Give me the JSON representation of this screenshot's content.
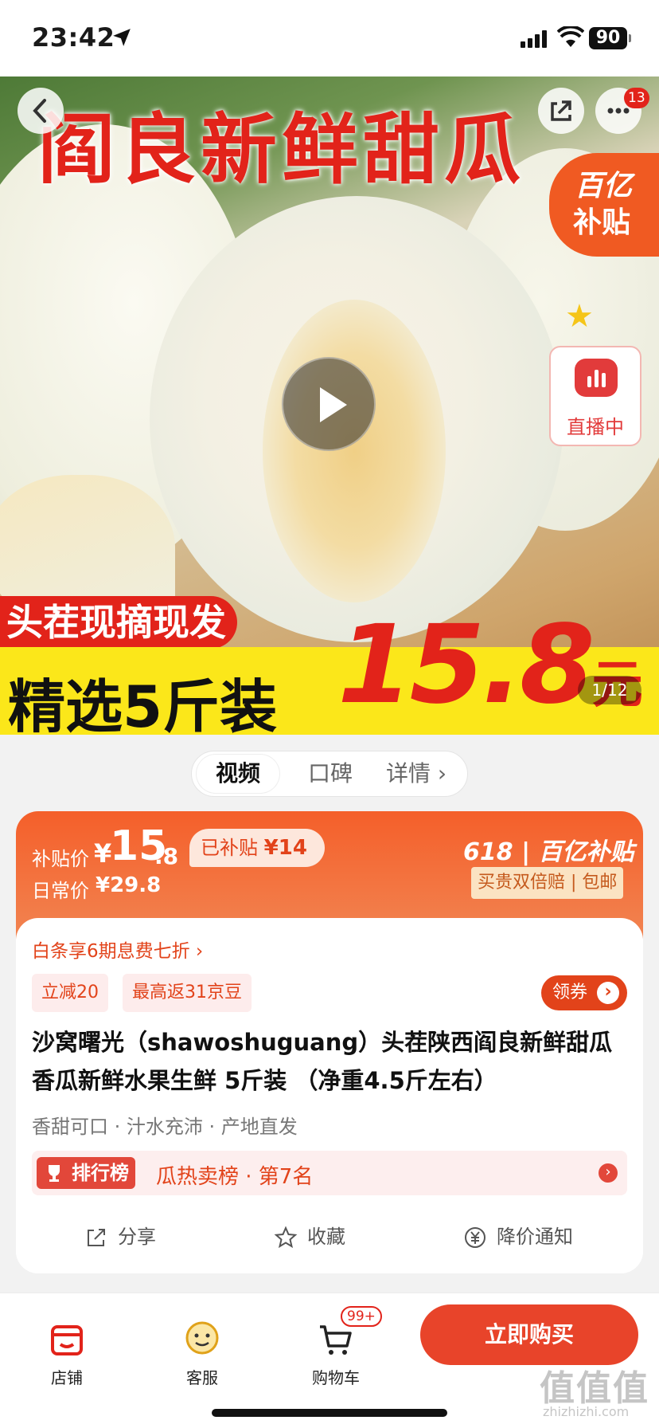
{
  "status_bar": {
    "time": "23:42",
    "battery": "90"
  },
  "hero": {
    "title": "阎良新鲜甜瓜",
    "more_badge": "13",
    "subsidy_line1": "百亿",
    "subsidy_line2": "补贴",
    "live_label": "直播中",
    "banner_red": "头茬现摘现发",
    "banner_yellow": "精选5斤装",
    "price_number": "15.8",
    "price_unit": "元",
    "page_indicator": "1/12"
  },
  "tabs": [
    {
      "label": "视频"
    },
    {
      "label": "口碑"
    },
    {
      "label": "详情 ›"
    }
  ],
  "price": {
    "subsidy_label": "补贴价",
    "currency": "¥",
    "subsidy_int": "15",
    "subsidy_dec": ".8",
    "subsidized_text": "已补贴",
    "subsidized_amount": "¥14",
    "daily_label": "日常价",
    "daily_price": "¥29.8",
    "promo_text": "618 | 百亿补贴 ›",
    "promo_badge": "买贵双倍赔 | 包邮"
  },
  "details": {
    "credit_line": "白条享6期息费七折 ›",
    "chips": [
      "立减20",
      "最高返31京豆"
    ],
    "coupon_button": "领券",
    "product_title": "沙窝曙光（shawoshuguang）头茬陕西阎良新鲜甜瓜香瓜新鲜水果生鲜 5斤装 （净重4.5斤左右）",
    "features": "香甜可口 · 汁水充沛 · 产地直发",
    "rank_tag": "排行榜",
    "rank_text": "瓜热卖榜 · 第7名",
    "actions": [
      "分享",
      "收藏",
      "降价通知"
    ]
  },
  "bottom_nav": {
    "store": "店铺",
    "service": "客服",
    "cart": "购物车",
    "cart_badge": "99+",
    "buy_button": "立即购买"
  },
  "watermark": {
    "main": "值值值",
    "sub": "zhizhizhi.com"
  },
  "colors": {
    "accent": "#e2231a",
    "orange": "#f45f2a",
    "yellow": "#fbe71a"
  }
}
